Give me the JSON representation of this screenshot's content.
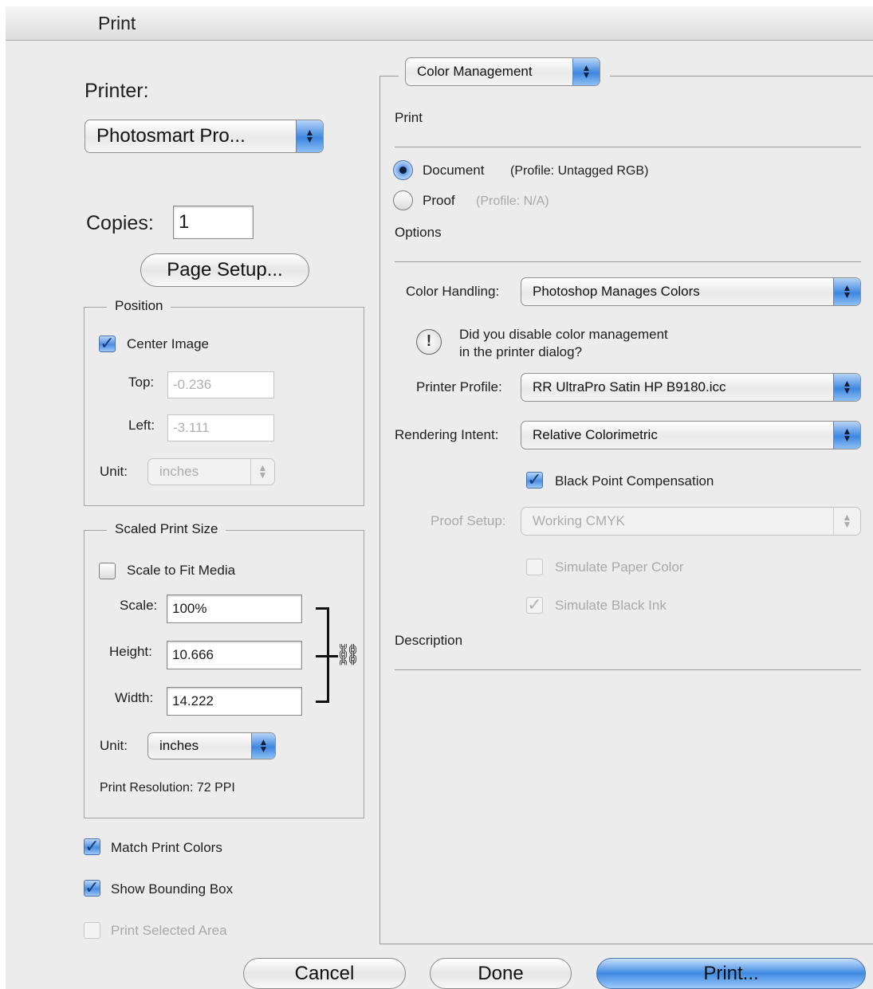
{
  "window": {
    "title": "Print"
  },
  "left": {
    "printer_label": "Printer:",
    "printer_value": "Photosmart Pro...",
    "copies_label": "Copies:",
    "copies_value": "1",
    "page_setup": "Page Setup...",
    "position": {
      "title": "Position",
      "center_image": "Center Image",
      "top_label": "Top:",
      "top_value": "-0.236",
      "left_label": "Left:",
      "left_value": "-3.111",
      "unit_label": "Unit:",
      "unit_value": "inches"
    },
    "scaled": {
      "title": "Scaled Print Size",
      "scale_to_fit": "Scale to Fit Media",
      "scale_label": "Scale:",
      "scale_value": "100%",
      "height_label": "Height:",
      "height_value": "10.666",
      "width_label": "Width:",
      "width_value": "14.222",
      "unit_label": "Unit:",
      "unit_value": "inches",
      "resolution": "Print Resolution: 72 PPI"
    },
    "match_print_colors": "Match Print Colors",
    "show_bounding_box": "Show Bounding Box",
    "print_selected_area": "Print Selected Area"
  },
  "right": {
    "section_popup": "Color Management",
    "print_header": "Print",
    "document_label": "Document",
    "document_profile": "(Profile: Untagged RGB)",
    "proof_label": "Proof",
    "proof_profile": "(Profile: N/A)",
    "options_header": "Options",
    "color_handling_label": "Color Handling:",
    "color_handling_value": "Photoshop Manages Colors",
    "warning_line1": "Did you disable color management",
    "warning_line2": "in the printer dialog?",
    "printer_profile_label": "Printer Profile:",
    "printer_profile_value": "RR UltraPro Satin HP B9180.icc",
    "rendering_intent_label": "Rendering Intent:",
    "rendering_intent_value": "Relative Colorimetric",
    "black_point": "Black Point Compensation",
    "proof_setup_label": "Proof Setup:",
    "proof_setup_value": "Working CMYK",
    "simulate_paper": "Simulate Paper Color",
    "simulate_black": "Simulate Black Ink",
    "description_header": "Description"
  },
  "buttons": {
    "cancel": "Cancel",
    "done": "Done",
    "print": "Print..."
  },
  "colors": {
    "accent": "#3f8ae3",
    "window_bg": "#ececec"
  }
}
